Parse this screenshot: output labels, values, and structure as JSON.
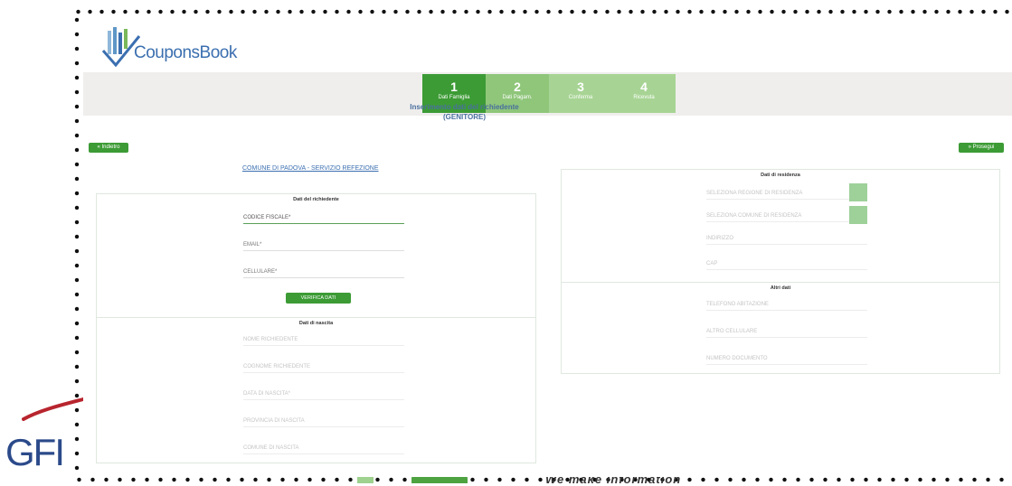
{
  "app": {
    "logo_text": "CouponsBook"
  },
  "steps": [
    {
      "number": "1",
      "label": "Dati Famiglia"
    },
    {
      "number": "2",
      "label": "Dati Pagam."
    },
    {
      "number": "3",
      "label": "Conferma"
    },
    {
      "number": "4",
      "label": "Ricevuta"
    }
  ],
  "page_title_line1": "Inserimento dati del richiedente",
  "page_title_line2": "(GENITORE)",
  "nav": {
    "back_label": "« Indietro",
    "next_label": "» Prosegui"
  },
  "section_link": "COMUNE DI PADOVA - SERVIZIO REFEZIONE",
  "left_panels": {
    "identification_title": "Dati del richiedente",
    "codice_fiscale": "CODICE FISCALE*",
    "email": "EMAIL*",
    "cellulare": "CELLULARE*",
    "verify_button": "VERIFICA DATI",
    "birth_title": "Dati di nascita",
    "nome": "NOME RICHIEDENTE",
    "cognome": "COGNOME RICHIEDENTE",
    "data_nascita": "DATA DI NASCITA*",
    "provincia_nascita": "PROVINCIA DI NASCITA",
    "comune_nascita": "COMUNE DI NASCITA"
  },
  "right_panels": {
    "residence_title": "Dati di residenza",
    "regione": "SELEZIONA REGIONE DI RESIDENZA",
    "comune_res": "SELEZIONA COMUNE DI RESIDENZA",
    "indirizzo": "INDIRIZZO",
    "cap": "CAP",
    "other_title": "Altri dati",
    "telefono": "TELEFONO ABITAZIONE",
    "altro_cellulare": "ALTRO CELLULARE",
    "numero_documento": "NUMERO DOCUMENTO"
  },
  "background": {
    "presenter_logo": "GFI",
    "tagline": "We make information"
  },
  "colors": {
    "primary_green": "#3c9b35",
    "light_green": "#a7d494",
    "link_blue": "#3b6fb0",
    "gfi_blue": "#2b4a8a"
  }
}
